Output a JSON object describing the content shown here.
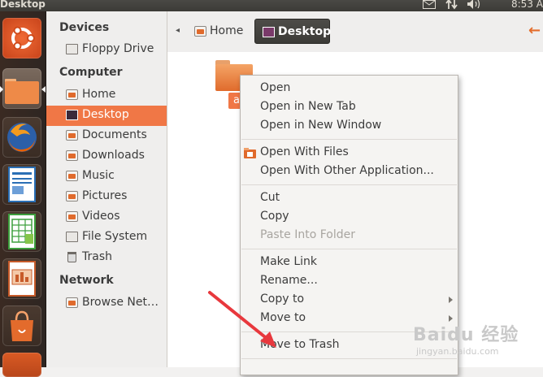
{
  "top_panel": {
    "window_title": "Desktop",
    "clock": "8:53 A",
    "icons": [
      "mail-icon",
      "network-icon",
      "volume-icon"
    ]
  },
  "launcher": {
    "apps": [
      {
        "name": "dash-home",
        "color": "#e95420"
      },
      {
        "name": "files",
        "color": "#e07a3a"
      },
      {
        "name": "firefox",
        "color": "#e66000"
      },
      {
        "name": "writer",
        "color": "#2a6fb5"
      },
      {
        "name": "calc",
        "color": "#3d9f3d"
      },
      {
        "name": "impress",
        "color": "#c75b2a"
      },
      {
        "name": "software-center",
        "color": "#e36b2c"
      },
      {
        "name": "more",
        "color": "#d04a1a"
      }
    ]
  },
  "sidebar": {
    "sections": [
      {
        "title": "Devices",
        "items": [
          {
            "label": "Floppy Drive",
            "icon": "floppy-icon"
          }
        ]
      },
      {
        "title": "Computer",
        "items": [
          {
            "label": "Home",
            "icon": "home-folder-icon"
          },
          {
            "label": "Desktop",
            "icon": "desktop-icon",
            "selected": true
          },
          {
            "label": "Documents",
            "icon": "folder-icon"
          },
          {
            "label": "Downloads",
            "icon": "folder-icon"
          },
          {
            "label": "Music",
            "icon": "folder-icon"
          },
          {
            "label": "Pictures",
            "icon": "folder-icon"
          },
          {
            "label": "Videos",
            "icon": "folder-icon"
          },
          {
            "label": "File System",
            "icon": "drive-icon"
          },
          {
            "label": "Trash",
            "icon": "trash-icon"
          }
        ]
      },
      {
        "title": "Network",
        "items": [
          {
            "label": "Browse Net…",
            "icon": "network-folder-icon"
          }
        ]
      }
    ]
  },
  "toolbar": {
    "breadcrumbs": [
      "Home",
      "Desktop"
    ],
    "active_crumb": "Desktop"
  },
  "content": {
    "file_label": "a"
  },
  "context_menu": {
    "groups": [
      [
        {
          "label": "Open"
        },
        {
          "label": "Open in New Tab"
        },
        {
          "label": "Open in New Window"
        }
      ],
      [
        {
          "label": "Open With Files",
          "icon": "files-app-icon"
        },
        {
          "label": "Open With Other Application..."
        }
      ],
      [
        {
          "label": "Cut"
        },
        {
          "label": "Copy"
        },
        {
          "label": "Paste Into Folder",
          "disabled": true
        }
      ],
      [
        {
          "label": "Make Link"
        },
        {
          "label": "Rename..."
        },
        {
          "label": "Copy to",
          "submenu": true
        },
        {
          "label": "Move to",
          "submenu": true
        }
      ],
      [
        {
          "label": "Move to Trash"
        }
      ]
    ]
  },
  "colors": {
    "accent": "#f07746",
    "panel": "#3c3b37",
    "annotation_arrow": "#e8383d"
  },
  "watermark": {
    "main": "Baidu 经验",
    "sub": "jingyan.baidu.com"
  }
}
